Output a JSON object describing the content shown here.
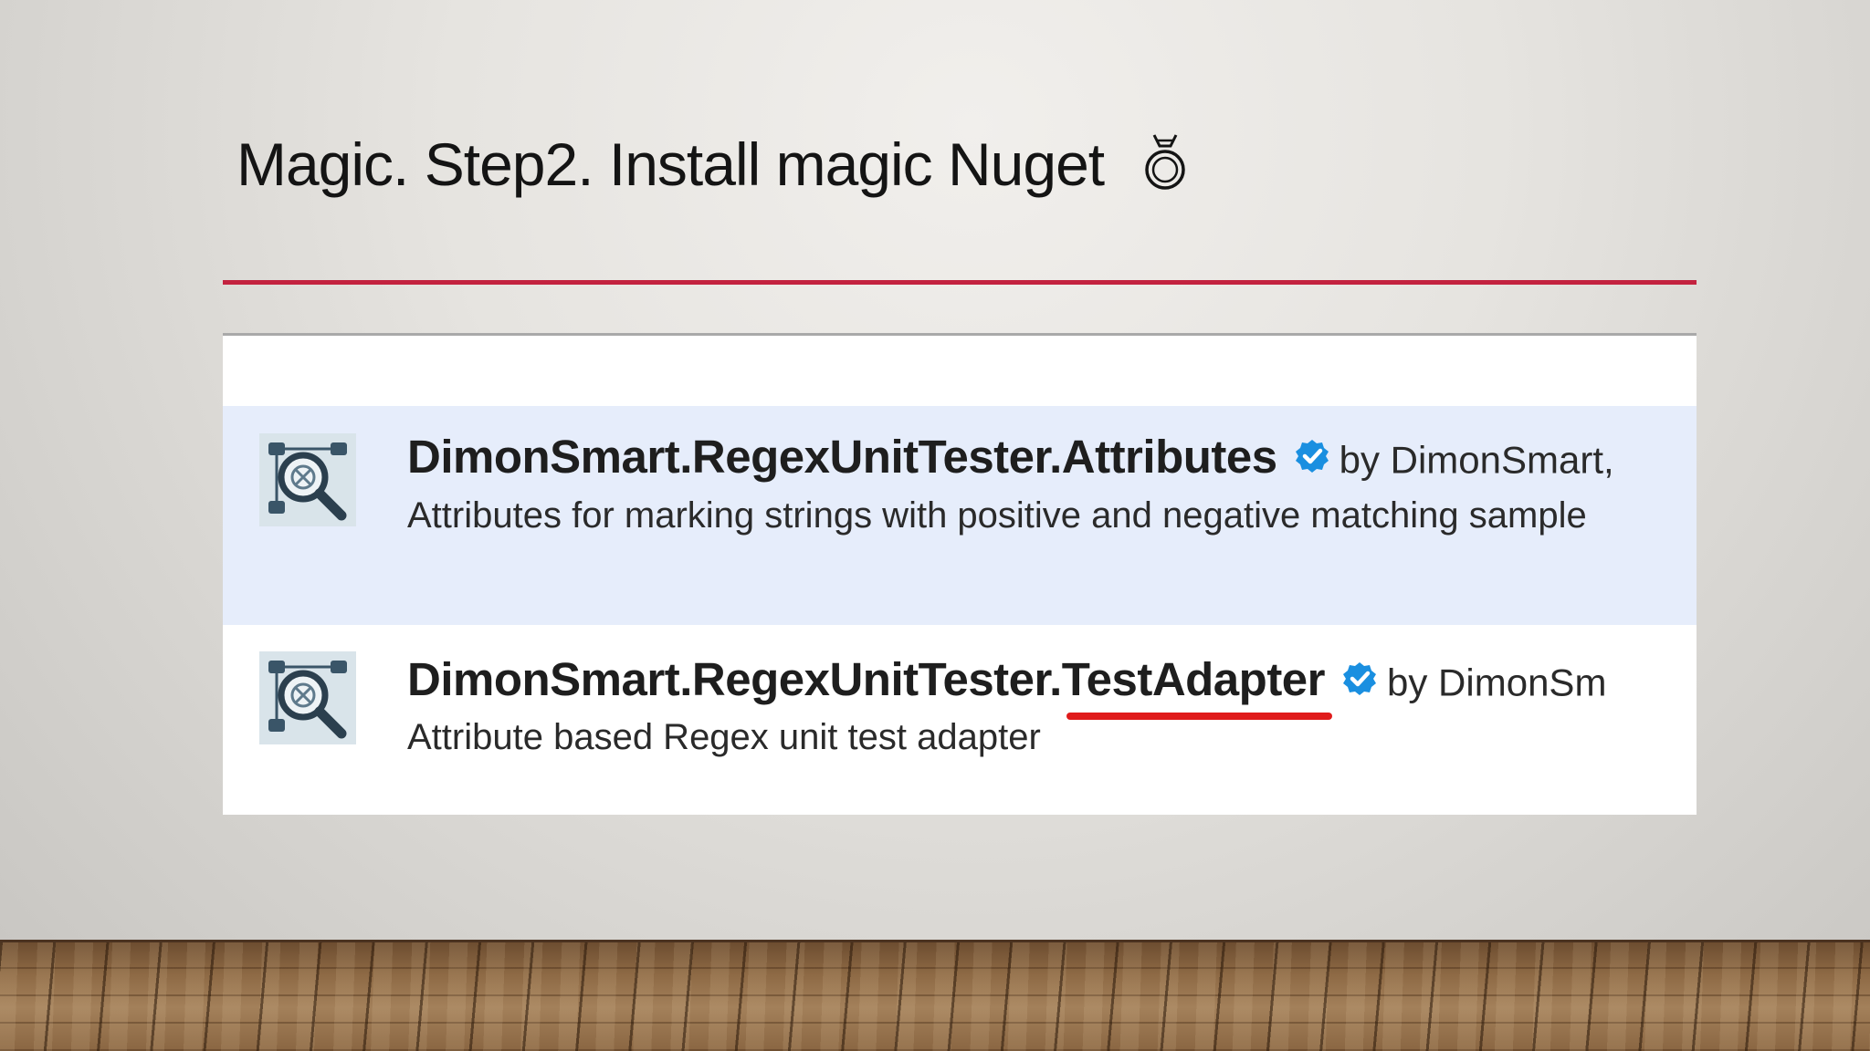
{
  "slide": {
    "title": "Magic. Step2. Install magic Nuget",
    "title_icon": "ring-icon",
    "accent_color": "#c3223f"
  },
  "packages": [
    {
      "icon": "package-icon",
      "name_prefix": "DimonSmart.RegexUnitTester.",
      "name_suffix": "Attributes",
      "verified_icon": "verified-check-icon",
      "author": "by DimonSmart,",
      "description": "Attributes for marking strings with positive and negative matching sample",
      "highlighted": false
    },
    {
      "icon": "package-icon",
      "name_prefix": "DimonSmart.RegexUnitTester.",
      "name_suffix": "TestAdapter",
      "verified_icon": "verified-check-icon",
      "author": "by DimonSm",
      "description": "Attribute based Regex unit test adapter",
      "highlighted": true,
      "highlight_color": "#e01b1b"
    }
  ],
  "colors": {
    "selected_row_bg": "#e6edfb",
    "verified_blue": "#1a8fe0"
  }
}
